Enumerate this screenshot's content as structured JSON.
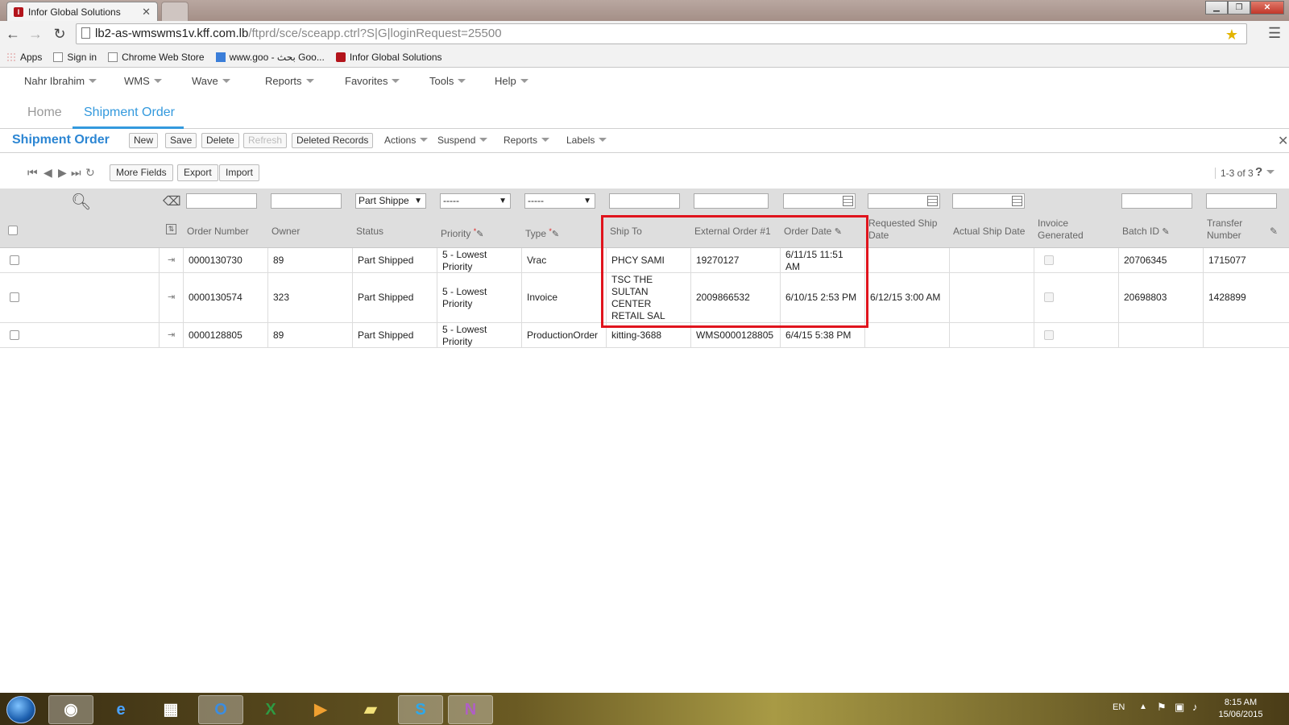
{
  "browser": {
    "tabs": [
      {
        "title": "Infor Global Solutions",
        "active": true
      },
      {
        "title": "",
        "active": false
      }
    ],
    "url_host": "lb2-as-wmswms1v.kff.com.lb",
    "url_path": "/ftprd/sce/sceapp.ctrl?S|G|loginRequest=25500",
    "bookmarks": [
      "Apps",
      "Sign in",
      "Chrome Web Store",
      "www.goo - بحث Goo...",
      "Infor Global Solutions"
    ]
  },
  "app_menu": [
    "Nahr Ibrahim",
    "WMS",
    "Wave",
    "Reports",
    "Favorites",
    "Tools",
    "Help"
  ],
  "page_tabs": [
    "Home",
    "Shipment Order"
  ],
  "form": {
    "title": "Shipment Order",
    "buttons": [
      "New",
      "Save",
      "Delete",
      "Refresh",
      "Deleted Records"
    ],
    "menus": [
      "Actions",
      "Suspend",
      "Reports",
      "Labels"
    ]
  },
  "grid_toolbar": {
    "buttons": [
      "More Fields",
      "Export",
      "Import"
    ],
    "count": "1-3 of 3",
    "help": "?"
  },
  "filters": {
    "status": "Part Shippe",
    "priority": "-----",
    "type": "-----"
  },
  "columns": [
    "Order Number",
    "Owner",
    "Status",
    "Priority",
    "Type",
    "Ship To",
    "External Order #1",
    "Order Date",
    "Requested Ship Date",
    "Actual Ship Date",
    "Invoice Generated",
    "Batch ID",
    "Transfer Number"
  ],
  "rows": [
    {
      "order": "0000130730",
      "owner": "89",
      "status": "Part Shipped",
      "priority": "5 - Lowest Priority",
      "type": "Vrac",
      "ship_to": "PHCY SAMI",
      "ext_order": "19270127",
      "order_date": "6/11/15 11:51 AM",
      "req_ship": "",
      "actual_ship": "",
      "batch": "20706345",
      "transfer": "1715077"
    },
    {
      "order": "0000130574",
      "owner": "323",
      "status": "Part Shipped",
      "priority": "5 - Lowest Priority",
      "type": "Invoice",
      "ship_to": "TSC THE SULTAN CENTER RETAIL SAL",
      "ext_order": "2009866532",
      "order_date": "6/10/15 2:53 PM",
      "req_ship": "6/12/15 3:00 AM",
      "actual_ship": "",
      "batch": "20698803",
      "transfer": "1428899"
    },
    {
      "order": "0000128805",
      "owner": "89",
      "status": "Part Shipped",
      "priority": "5 - Lowest Priority",
      "type": "ProductionOrder",
      "ship_to": "kitting-3688",
      "ext_order": "WMS0000128805",
      "order_date": "6/4/15 5:38 PM",
      "req_ship": "",
      "actual_ship": "",
      "batch": "",
      "transfer": ""
    }
  ],
  "taskbar": {
    "lang": "EN",
    "time": "8:15 AM",
    "date": "15/06/2015"
  },
  "colors": {
    "accent": "#3399dd",
    "highlight": "#e0141d"
  }
}
